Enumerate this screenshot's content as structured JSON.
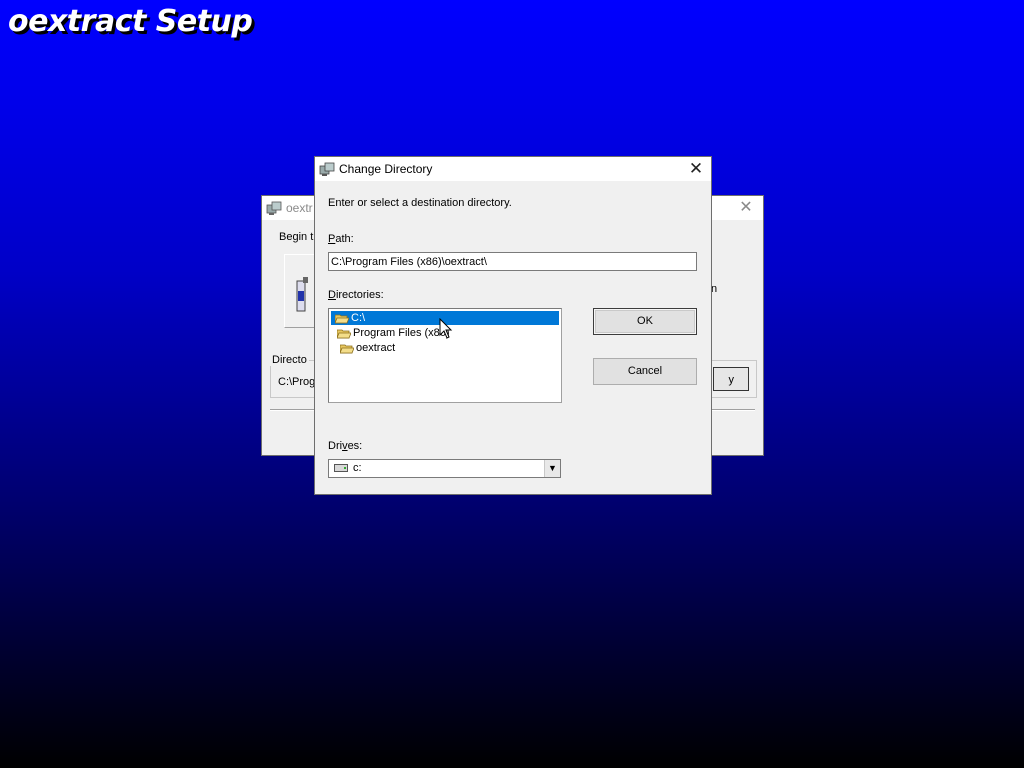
{
  "setup_title": "oextract Setup",
  "background_window": {
    "title_fragment": "oextr",
    "begin_fragment": "Begin t",
    "right_fragment": "n",
    "group_label_fragment": "Directo",
    "path_fragment": "C:\\Prog",
    "change_button_fragment": "y"
  },
  "dialog": {
    "title": "Change Directory",
    "instruction": "Enter or select a destination directory.",
    "path_label_prefix": "P",
    "path_label_rest": "ath:",
    "path_value": "C:\\Program Files (x86)\\oextract\\",
    "directories_label_prefix": "D",
    "directories_label_rest": "irectories:",
    "directories": [
      {
        "name": "C:\\",
        "selected": true
      },
      {
        "name": "Program Files (x86)",
        "selected": false
      },
      {
        "name": "oextract",
        "selected": false
      }
    ],
    "ok_label": "OK",
    "cancel_label": "Cancel",
    "drives_label_prefix": "Dri",
    "drives_label_u": "v",
    "drives_label_rest": "es:",
    "drive_value": "c:",
    "close_glyph": "✕"
  },
  "colors": {
    "selection": "#0078d7",
    "folder": "#e8c860",
    "desktop_top": "#0000ff",
    "desktop_bottom": "#000000"
  }
}
